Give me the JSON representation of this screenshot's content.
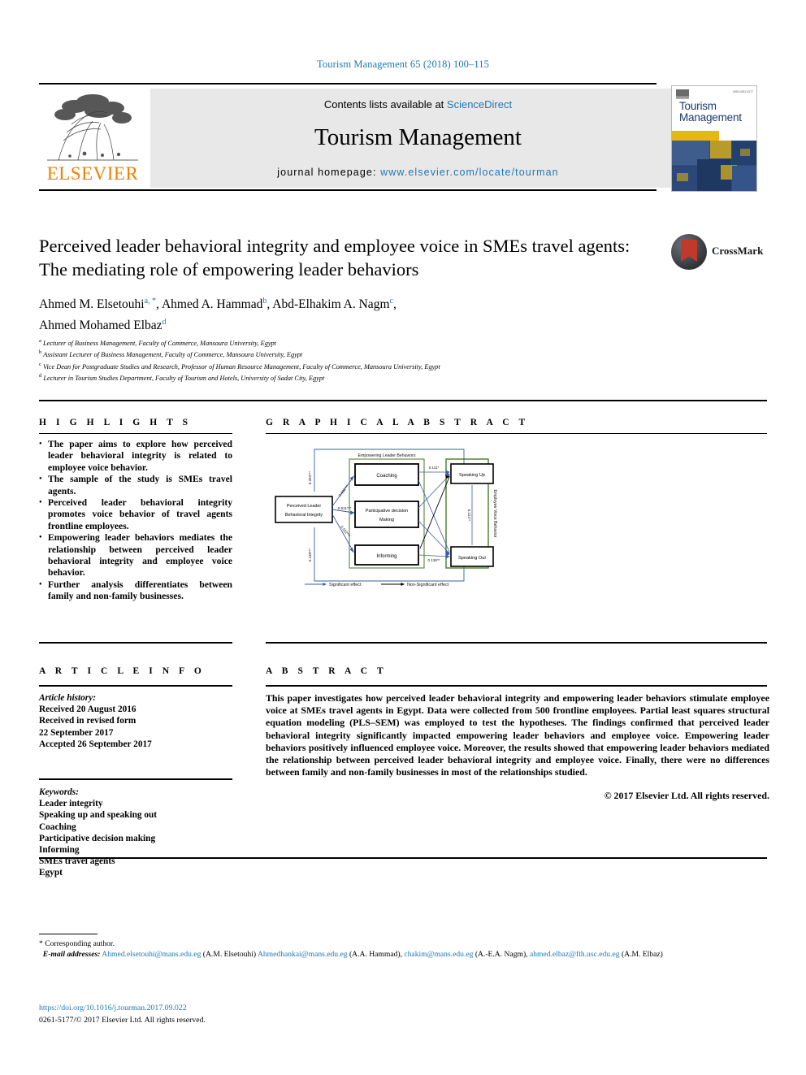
{
  "running_head": "Tourism Management 65 (2018) 100–115",
  "masthead": {
    "contents_prefix": "Contents lists available at ",
    "contents_link": "ScienceDirect",
    "journal_title": "Tourism Management",
    "homepage_prefix": "journal homepage: ",
    "homepage_url": "www.elsevier.com/locate/tourman",
    "publisher": "ELSEVIER",
    "cover": {
      "line1": "Tourism",
      "line2": "Management",
      "issn_code": "ISSN 0261-5177"
    }
  },
  "article": {
    "title": "Perceived leader behavioral integrity and employee voice in SMEs travel agents: The mediating role of empowering leader behaviors",
    "authors": [
      {
        "name": "Ahmed M. Elsetouhi",
        "marks": "a, *"
      },
      {
        "name": "Ahmed A. Hammad",
        "marks": "b"
      },
      {
        "name": "Abd-Elhakim A. Nagm",
        "marks": "c"
      },
      {
        "name": "Ahmed Mohamed Elbaz",
        "marks": "d"
      }
    ],
    "affiliations": [
      {
        "mark": "a",
        "text": "Lecturer of Business Management, Faculty of Commerce, Mansoura University, Egypt"
      },
      {
        "mark": "b",
        "text": "Assistant Lecturer of Business Management, Faculty of Commerce, Mansoura University, Egypt"
      },
      {
        "mark": "c",
        "text": "Vice Dean for Postgraduate Studies and Research, Professor of Human Resource Management, Faculty of Commerce, Mansoura University, Egypt"
      },
      {
        "mark": "d",
        "text": "Lecturer in Tourism Studies Department, Faculty of Tourism and Hotels, University of Sadat City, Egypt"
      }
    ],
    "crossmark_label": "CrossMark"
  },
  "highlights": {
    "heading": "H I G H L I G H T S",
    "items": [
      "The paper aims to explore how perceived leader behavioral integrity is related to employee voice behavior.",
      "The sample of the study is SMEs travel agents.",
      "Perceived leader behavioral integrity promotes voice behavior of travel agents frontline employees.",
      "Empowering leader behaviors mediates the relationship between perceived leader behavioral integrity and employee voice behavior.",
      "Further analysis differentiates between family and non-family businesses."
    ]
  },
  "graphical_abstract": {
    "heading": "G R A P H I C A L   A B S T R A C T",
    "predictor": "Perceived Leader Behavioral Integrity",
    "mediator_group_label": "Empowering Leader Behaviors",
    "mediators": [
      "Coaching",
      "Participative decision Making",
      "Informing"
    ],
    "outcome_group_label": "Employee Voice Behavior",
    "outcomes": [
      "Speaking Up",
      "Speaking Out"
    ],
    "legend": [
      {
        "label": "Significant effect",
        "color": "#3b5ca8"
      },
      {
        "label": "Non-Significant effect",
        "color": "#000000"
      }
    ]
  },
  "article_info": {
    "heading": "A R T I C L E   I N F O",
    "history_label": "Article history:",
    "history": [
      "Received 20 August 2016",
      "Received in revised form",
      "22 September 2017",
      "Accepted 26 September 2017"
    ],
    "keywords_label": "Keywords:",
    "keywords": [
      "Leader integrity",
      "Speaking up and speaking out",
      "Coaching",
      "Participative decision making",
      "Informing",
      "SMEs travel agents",
      "Egypt"
    ]
  },
  "abstract": {
    "heading": "A B S T R A C T",
    "text": "This paper investigates how perceived leader behavioral integrity and empowering leader behaviors stimulate employee voice at SMEs travel agents in Egypt. Data were collected from 500 frontline employees. Partial least squares structural equation modeling (PLS–SEM) was employed to test the hypotheses. The findings confirmed that perceived leader behavioral integrity significantly impacted empowering leader behaviors and employee voice. Empowering leader behaviors positively influenced employee voice. Moreover, the results showed that empowering leader behaviors mediated the relationship between perceived leader behavioral integrity and employee voice. Finally, there were no differences between family and non-family businesses in most of the relationships studied.",
    "copyright": "© 2017 Elsevier Ltd. All rights reserved."
  },
  "footer": {
    "corresponding": "* Corresponding author.",
    "email_label": "E-mail addresses:",
    "emails": [
      {
        "address": "Ahmed.elsetouhi@mans.edu.eg",
        "owner": "(A.M. Elsetouhi)"
      },
      {
        "address": "Ahmedhankai@mans.edu.eg",
        "owner": "(A.A. Hammad)"
      },
      {
        "address": "chakim@mans.edu.eg",
        "owner": "(A.-E.A. Nagm)"
      },
      {
        "address": "ahmed.elbaz@fth.usc.edu.eg",
        "owner": "(A.M. Elbaz)"
      }
    ],
    "doi": "https://doi.org/10.1016/j.tourman.2017.09.022",
    "issn_line": "0261-5177/© 2017 Elsevier Ltd. All rights reserved."
  }
}
